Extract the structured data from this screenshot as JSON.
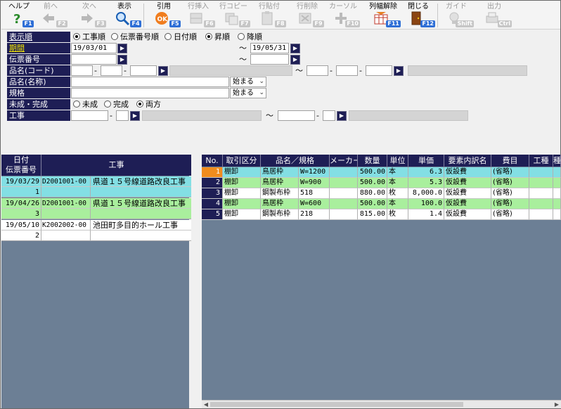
{
  "toolbar": {
    "items": [
      {
        "label": "ヘルプ",
        "key": "F1",
        "icon": "help-icon",
        "enabled": true
      },
      {
        "label": "前へ",
        "key": "F2",
        "icon": "arrow-left-icon",
        "enabled": false
      },
      {
        "label": "次へ",
        "key": "F3",
        "icon": "arrow-right-icon",
        "enabled": false
      },
      {
        "label": "表示",
        "key": "F4",
        "icon": "magnifier-icon",
        "enabled": true
      },
      {
        "label": "引用",
        "key": "F5",
        "icon": "ok-icon",
        "enabled": true
      },
      {
        "label": "行挿入",
        "key": "F6",
        "icon": "row-insert-icon",
        "enabled": false
      },
      {
        "label": "行コピー",
        "key": "F7",
        "icon": "row-copy-icon",
        "enabled": false
      },
      {
        "label": "行貼付",
        "key": "F8",
        "icon": "row-paste-icon",
        "enabled": false
      },
      {
        "label": "行削除",
        "key": "F9",
        "icon": "row-delete-icon",
        "enabled": false
      },
      {
        "label": "カーソル",
        "key": "F10",
        "icon": "cursor-icon",
        "enabled": false
      },
      {
        "label": "列幅解除",
        "key": "F11",
        "icon": "column-width-icon",
        "enabled": true
      },
      {
        "label": "閉じる",
        "key": "F12",
        "icon": "door-icon",
        "enabled": true
      },
      {
        "label": "ガイド",
        "key": "Shift",
        "icon": "guide-bulb-icon",
        "enabled": false
      },
      {
        "label": "出力",
        "key": "Ctrl",
        "icon": "output-icon",
        "enabled": false
      }
    ]
  },
  "form": {
    "display_order": {
      "label": "表示順",
      "options": [
        "工事順",
        "伝票番号順",
        "日付順"
      ],
      "selected": "工事順",
      "direction_options": [
        "昇順",
        "降順"
      ],
      "direction_selected": "昇順"
    },
    "period": {
      "label": "期間",
      "from": "19/03/01",
      "to": "19/05/31",
      "tilde": "～"
    },
    "slip_number": {
      "label": "伝票番号",
      "from": "",
      "to": ""
    },
    "item_code": {
      "label": "品名(コード)"
    },
    "item_name": {
      "label": "品名(名称)",
      "mode": "始まる"
    },
    "spec": {
      "label": "規格",
      "mode": "始まる"
    },
    "status": {
      "label": "未成・完成",
      "options": [
        "未成",
        "完成",
        "両方"
      ],
      "selected": "両方"
    },
    "construction": {
      "label": "工事"
    },
    "dash": "-"
  },
  "left_table": {
    "headers": {
      "date": "日付",
      "slip": "伝票番号",
      "construction": "工事"
    },
    "rows": [
      {
        "date": "19/03/29",
        "code": "D2001001-00",
        "name": "県道１５号線道路改良工事",
        "slip": "1",
        "color": "#83dfe4"
      },
      {
        "date": "19/04/26",
        "code": "D2001001-00",
        "name": "県道１５号線道路改良工事",
        "slip": "3",
        "color": "#a9ef9d"
      },
      {
        "date": "19/05/10",
        "code": "K2002002-00",
        "name": "池田町多目的ホール工事",
        "slip": "2",
        "color": "#ffffff"
      }
    ]
  },
  "right_table": {
    "headers": [
      "No.",
      "取引区分",
      "品名／規格",
      "メーカー",
      "数量",
      "単位",
      "単価",
      "要素内訳名",
      "費目",
      "工種",
      "種"
    ],
    "rows": [
      {
        "no": "1",
        "type": "棚卸",
        "name": "鳥居枠",
        "spec": "W=1200",
        "maker": "",
        "qty": "500.00",
        "unit": "本",
        "price": "6.3",
        "element": "仮設費",
        "expense": "(省略)",
        "color": "#83dfe4"
      },
      {
        "no": "2",
        "type": "棚卸",
        "name": "鳥居枠",
        "spec": "W=900",
        "maker": "",
        "qty": "500.00",
        "unit": "本",
        "price": "5.3",
        "element": "仮設費",
        "expense": "(省略)",
        "color": "#a9ef9d"
      },
      {
        "no": "3",
        "type": "棚卸",
        "name": "鋼製布枠",
        "spec": "518",
        "maker": "",
        "qty": "880.00",
        "unit": "枚",
        "price": "8,000.0",
        "element": "仮設費",
        "expense": "(省略)",
        "color": "#ffffff"
      },
      {
        "no": "4",
        "type": "棚卸",
        "name": "鳥居枠",
        "spec": "W=600",
        "maker": "",
        "qty": "500.00",
        "unit": "本",
        "price": "100.0",
        "element": "仮設費",
        "expense": "(省略)",
        "color": "#a9ef9d"
      },
      {
        "no": "5",
        "type": "棚卸",
        "name": "鋼製布枠",
        "spec": "218",
        "maker": "",
        "qty": "815.00",
        "unit": "枚",
        "price": "1.4",
        "element": "仮設費",
        "expense": "(省略)",
        "color": "#ffffff"
      }
    ],
    "current_row": "1"
  }
}
